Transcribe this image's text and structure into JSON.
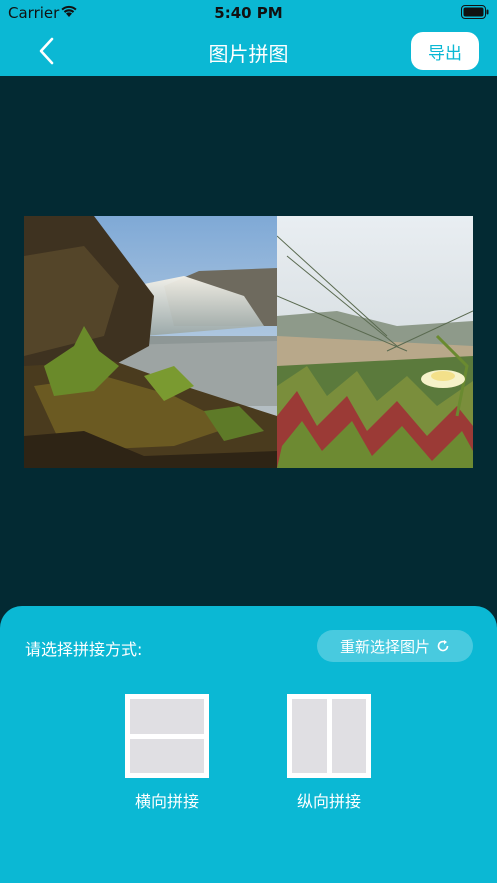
{
  "status_bar": {
    "carrier": "Carrier",
    "time": "5:40 PM"
  },
  "nav": {
    "title": "图片拼图",
    "export_label": "导出",
    "back_icon": "chevron-left-icon"
  },
  "colors": {
    "accent": "#0bb8d4",
    "canvas_bg": "#032a33",
    "cell": "#e0dfe3"
  },
  "collage": {
    "photos": [
      {
        "name": "waterfall-photo",
        "description_icon": "photo"
      },
      {
        "name": "flower-photo",
        "description_icon": "photo"
      }
    ]
  },
  "panel": {
    "choose_label": "请选择拼接方式:",
    "reselect_label": "重新选择图片",
    "options": [
      {
        "label": "横向拼接"
      },
      {
        "label": "纵向拼接"
      }
    ]
  }
}
